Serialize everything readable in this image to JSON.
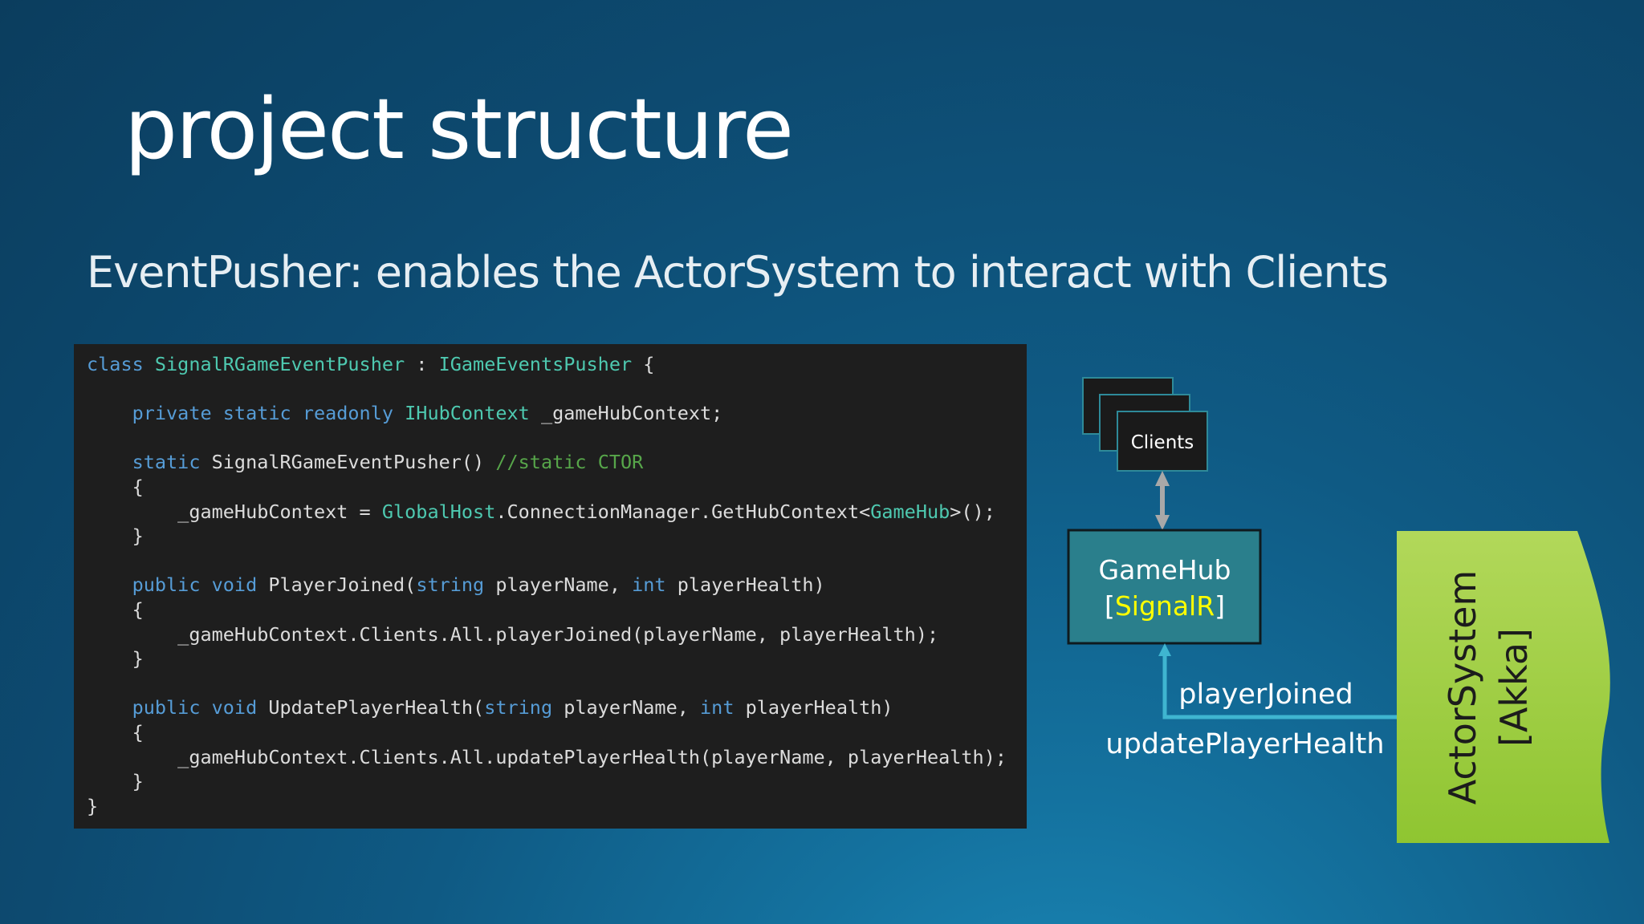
{
  "slide": {
    "title": "project structure",
    "subtitle": "EventPusher: enables the ActorSystem to interact with Clients"
  },
  "code": {
    "lines": [
      [
        {
          "t": "class ",
          "c": "kw"
        },
        {
          "t": "SignalRGameEventPusher",
          "c": "type"
        },
        {
          "t": " : ",
          "c": "plain"
        },
        {
          "t": "IGameEventsPusher",
          "c": "type"
        },
        {
          "t": " {",
          "c": "plain"
        }
      ],
      [],
      [
        {
          "t": "    ",
          "c": "plain"
        },
        {
          "t": "private static readonly ",
          "c": "kw"
        },
        {
          "t": "IHubContext",
          "c": "type"
        },
        {
          "t": " _gameHubContext;",
          "c": "plain"
        }
      ],
      [],
      [
        {
          "t": "    ",
          "c": "plain"
        },
        {
          "t": "static ",
          "c": "kw"
        },
        {
          "t": "SignalRGameEventPusher() ",
          "c": "plain"
        },
        {
          "t": "//static CTOR",
          "c": "comment"
        }
      ],
      [
        {
          "t": "    {",
          "c": "plain"
        }
      ],
      [
        {
          "t": "        _gameHubContext = ",
          "c": "plain"
        },
        {
          "t": "GlobalHost",
          "c": "type"
        },
        {
          "t": ".ConnectionManager.GetHubContext<",
          "c": "plain"
        },
        {
          "t": "GameHub",
          "c": "type"
        },
        {
          "t": ">();",
          "c": "plain"
        }
      ],
      [
        {
          "t": "    }",
          "c": "plain"
        }
      ],
      [],
      [
        {
          "t": "    ",
          "c": "plain"
        },
        {
          "t": "public void ",
          "c": "kw"
        },
        {
          "t": "PlayerJoined(",
          "c": "plain"
        },
        {
          "t": "string",
          "c": "kw"
        },
        {
          "t": " playerName, ",
          "c": "plain"
        },
        {
          "t": "int",
          "c": "kw"
        },
        {
          "t": " playerHealth)",
          "c": "plain"
        }
      ],
      [
        {
          "t": "    {",
          "c": "plain"
        }
      ],
      [
        {
          "t": "        _gameHubContext.Clients.All.playerJoined(playerName, playerHealth);",
          "c": "plain"
        }
      ],
      [
        {
          "t": "    }",
          "c": "plain"
        }
      ],
      [],
      [
        {
          "t": "    ",
          "c": "plain"
        },
        {
          "t": "public void ",
          "c": "kw"
        },
        {
          "t": "UpdatePlayerHealth(",
          "c": "plain"
        },
        {
          "t": "string",
          "c": "kw"
        },
        {
          "t": " playerName, ",
          "c": "plain"
        },
        {
          "t": "int",
          "c": "kw"
        },
        {
          "t": " playerHealth)",
          "c": "plain"
        }
      ],
      [
        {
          "t": "    {",
          "c": "plain"
        }
      ],
      [
        {
          "t": "        _gameHubContext.Clients.All.updatePlayerHealth(playerName, playerHealth);",
          "c": "plain"
        }
      ],
      [
        {
          "t": "    }",
          "c": "plain"
        }
      ],
      [
        {
          "t": "}",
          "c": "plain"
        }
      ]
    ]
  },
  "diagram": {
    "clients_label": "Clients",
    "gamehub_label": "GameHub",
    "signalr_open": "[",
    "signalr_label": "SignalR",
    "signalr_close": "]",
    "actorsystem_label": "ActorSystem",
    "akka_label": "[Akka]",
    "event_player_joined": "playerJoined",
    "event_update_health": "updatePlayerHealth"
  },
  "colors": {
    "code_keyword": "#569cd6",
    "code_type": "#4ec9b0",
    "code_comment": "#57a64a",
    "code_text": "#dcdcdc",
    "code_background": "#1e1e1e",
    "gamehub_fill": "#2a7f8c",
    "signalr_highlight": "#ffff00",
    "actorsystem_fill": "#9acd32",
    "connector": "#3fb5d0",
    "clients_fill": "#1a1a1a",
    "clients_border": "#2e8a99"
  }
}
